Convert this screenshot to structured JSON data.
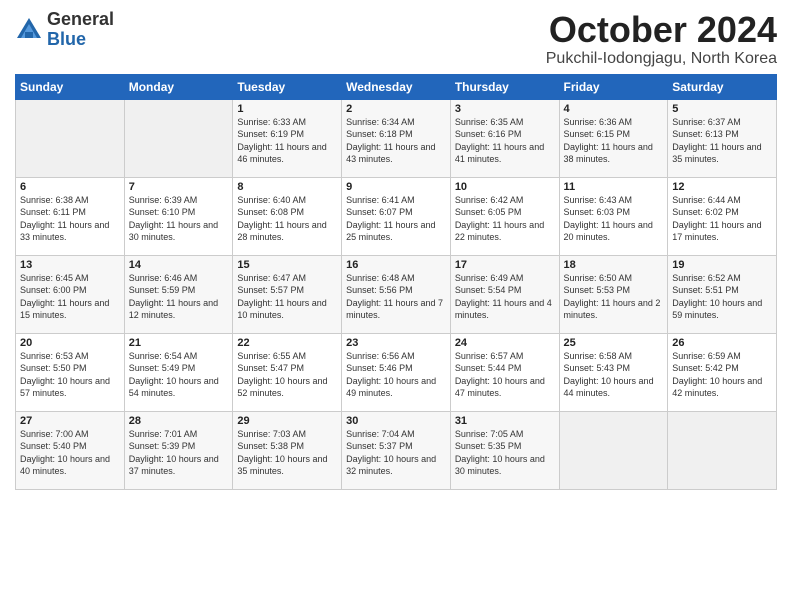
{
  "logo": {
    "general": "General",
    "blue": "Blue"
  },
  "header": {
    "month": "October 2024",
    "location": "Pukchil-Iodongjagu, North Korea"
  },
  "weekdays": [
    "Sunday",
    "Monday",
    "Tuesday",
    "Wednesday",
    "Thursday",
    "Friday",
    "Saturday"
  ],
  "weeks": [
    [
      {
        "day": "",
        "info": ""
      },
      {
        "day": "",
        "info": ""
      },
      {
        "day": "1",
        "info": "Sunrise: 6:33 AM\nSunset: 6:19 PM\nDaylight: 11 hours\nand 46 minutes."
      },
      {
        "day": "2",
        "info": "Sunrise: 6:34 AM\nSunset: 6:18 PM\nDaylight: 11 hours\nand 43 minutes."
      },
      {
        "day": "3",
        "info": "Sunrise: 6:35 AM\nSunset: 6:16 PM\nDaylight: 11 hours\nand 41 minutes."
      },
      {
        "day": "4",
        "info": "Sunrise: 6:36 AM\nSunset: 6:15 PM\nDaylight: 11 hours\nand 38 minutes."
      },
      {
        "day": "5",
        "info": "Sunrise: 6:37 AM\nSunset: 6:13 PM\nDaylight: 11 hours\nand 35 minutes."
      }
    ],
    [
      {
        "day": "6",
        "info": "Sunrise: 6:38 AM\nSunset: 6:11 PM\nDaylight: 11 hours\nand 33 minutes."
      },
      {
        "day": "7",
        "info": "Sunrise: 6:39 AM\nSunset: 6:10 PM\nDaylight: 11 hours\nand 30 minutes."
      },
      {
        "day": "8",
        "info": "Sunrise: 6:40 AM\nSunset: 6:08 PM\nDaylight: 11 hours\nand 28 minutes."
      },
      {
        "day": "9",
        "info": "Sunrise: 6:41 AM\nSunset: 6:07 PM\nDaylight: 11 hours\nand 25 minutes."
      },
      {
        "day": "10",
        "info": "Sunrise: 6:42 AM\nSunset: 6:05 PM\nDaylight: 11 hours\nand 22 minutes."
      },
      {
        "day": "11",
        "info": "Sunrise: 6:43 AM\nSunset: 6:03 PM\nDaylight: 11 hours\nand 20 minutes."
      },
      {
        "day": "12",
        "info": "Sunrise: 6:44 AM\nSunset: 6:02 PM\nDaylight: 11 hours\nand 17 minutes."
      }
    ],
    [
      {
        "day": "13",
        "info": "Sunrise: 6:45 AM\nSunset: 6:00 PM\nDaylight: 11 hours\nand 15 minutes."
      },
      {
        "day": "14",
        "info": "Sunrise: 6:46 AM\nSunset: 5:59 PM\nDaylight: 11 hours\nand 12 minutes."
      },
      {
        "day": "15",
        "info": "Sunrise: 6:47 AM\nSunset: 5:57 PM\nDaylight: 11 hours\nand 10 minutes."
      },
      {
        "day": "16",
        "info": "Sunrise: 6:48 AM\nSunset: 5:56 PM\nDaylight: 11 hours\nand 7 minutes."
      },
      {
        "day": "17",
        "info": "Sunrise: 6:49 AM\nSunset: 5:54 PM\nDaylight: 11 hours\nand 4 minutes."
      },
      {
        "day": "18",
        "info": "Sunrise: 6:50 AM\nSunset: 5:53 PM\nDaylight: 11 hours\nand 2 minutes."
      },
      {
        "day": "19",
        "info": "Sunrise: 6:52 AM\nSunset: 5:51 PM\nDaylight: 10 hours\nand 59 minutes."
      }
    ],
    [
      {
        "day": "20",
        "info": "Sunrise: 6:53 AM\nSunset: 5:50 PM\nDaylight: 10 hours\nand 57 minutes."
      },
      {
        "day": "21",
        "info": "Sunrise: 6:54 AM\nSunset: 5:49 PM\nDaylight: 10 hours\nand 54 minutes."
      },
      {
        "day": "22",
        "info": "Sunrise: 6:55 AM\nSunset: 5:47 PM\nDaylight: 10 hours\nand 52 minutes."
      },
      {
        "day": "23",
        "info": "Sunrise: 6:56 AM\nSunset: 5:46 PM\nDaylight: 10 hours\nand 49 minutes."
      },
      {
        "day": "24",
        "info": "Sunrise: 6:57 AM\nSunset: 5:44 PM\nDaylight: 10 hours\nand 47 minutes."
      },
      {
        "day": "25",
        "info": "Sunrise: 6:58 AM\nSunset: 5:43 PM\nDaylight: 10 hours\nand 44 minutes."
      },
      {
        "day": "26",
        "info": "Sunrise: 6:59 AM\nSunset: 5:42 PM\nDaylight: 10 hours\nand 42 minutes."
      }
    ],
    [
      {
        "day": "27",
        "info": "Sunrise: 7:00 AM\nSunset: 5:40 PM\nDaylight: 10 hours\nand 40 minutes."
      },
      {
        "day": "28",
        "info": "Sunrise: 7:01 AM\nSunset: 5:39 PM\nDaylight: 10 hours\nand 37 minutes."
      },
      {
        "day": "29",
        "info": "Sunrise: 7:03 AM\nSunset: 5:38 PM\nDaylight: 10 hours\nand 35 minutes."
      },
      {
        "day": "30",
        "info": "Sunrise: 7:04 AM\nSunset: 5:37 PM\nDaylight: 10 hours\nand 32 minutes."
      },
      {
        "day": "31",
        "info": "Sunrise: 7:05 AM\nSunset: 5:35 PM\nDaylight: 10 hours\nand 30 minutes."
      },
      {
        "day": "",
        "info": ""
      },
      {
        "day": "",
        "info": ""
      }
    ]
  ]
}
